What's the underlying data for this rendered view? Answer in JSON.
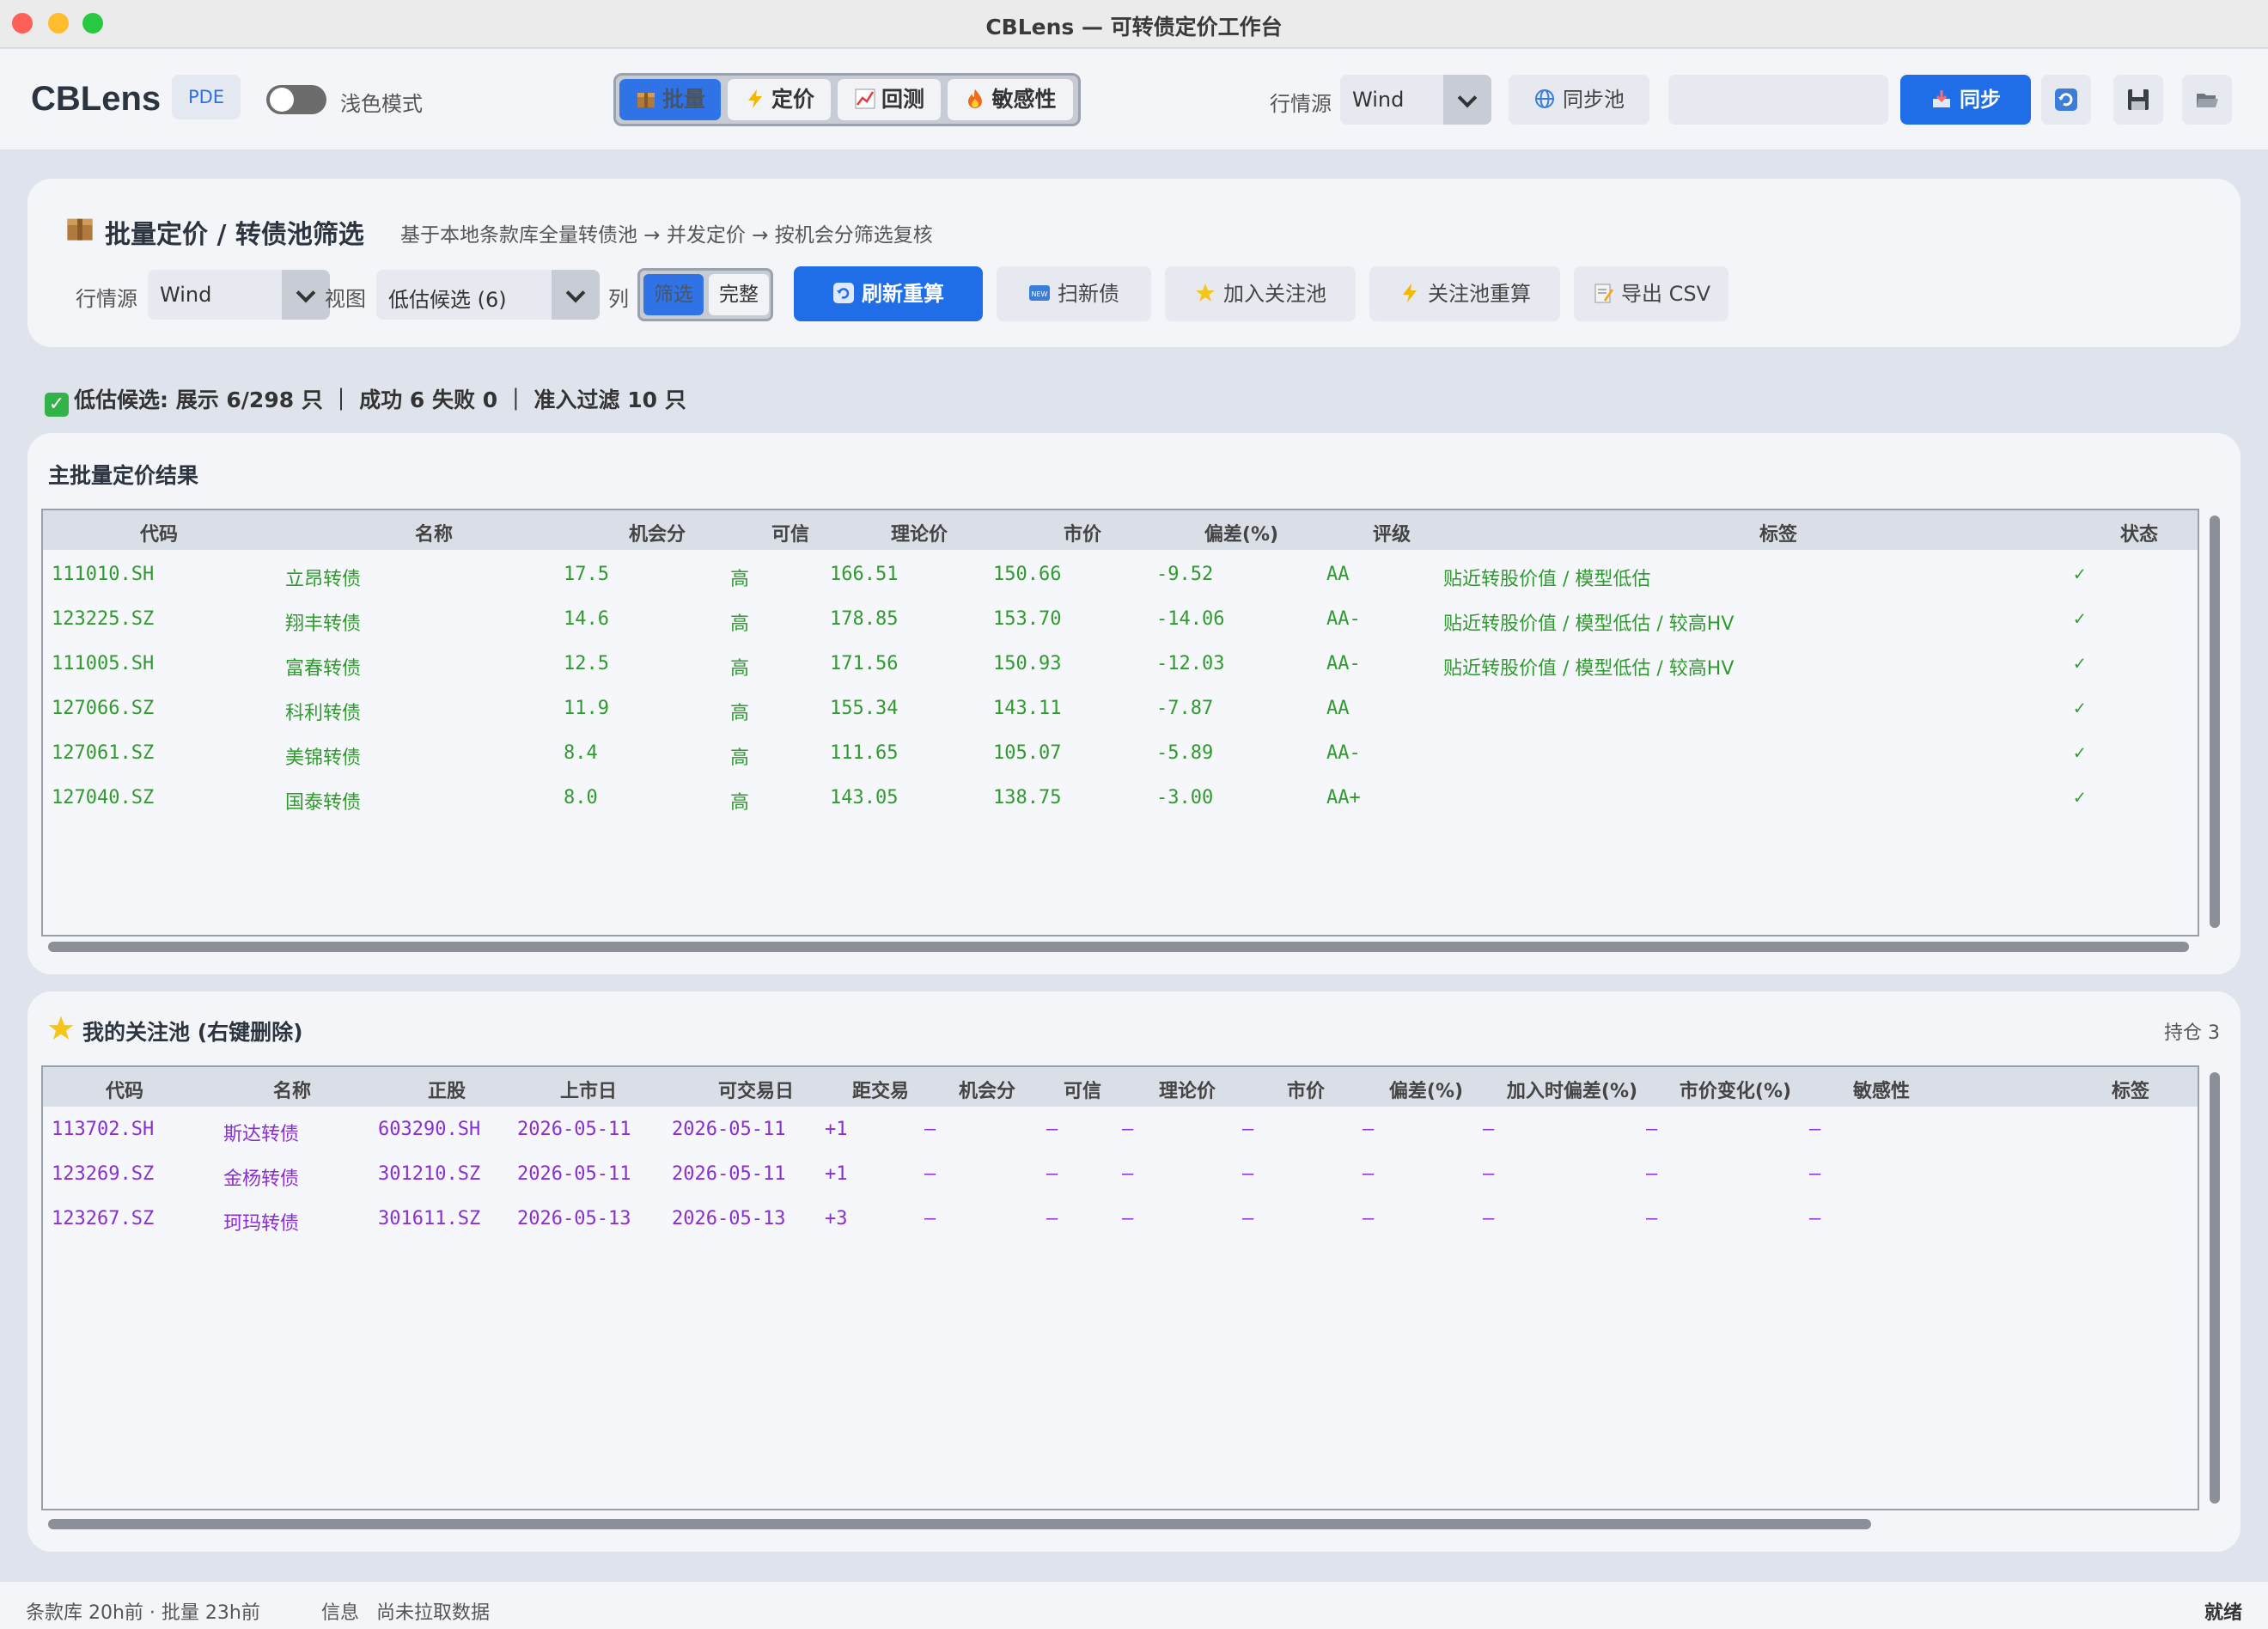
{
  "window": {
    "title": "CBLens — 可转债定价工作台"
  },
  "toolbar": {
    "brand": "CBLens",
    "badge": "PDE",
    "theme_toggle_label": "浅色模式",
    "tabs": [
      {
        "label": "批量",
        "icon": "package-icon",
        "active": true
      },
      {
        "label": "定价",
        "icon": "lightning-icon",
        "active": false
      },
      {
        "label": "回测",
        "icon": "chart-icon",
        "active": false
      },
      {
        "label": "敏感性",
        "icon": "fire-icon",
        "active": false
      }
    ],
    "source_label": "行情源",
    "source_value": "Wind",
    "sync_pool_label": "同步池",
    "sync_input_value": "",
    "sync_button_label": "同步",
    "accent_color": "#1f6ee8"
  },
  "batch_panel": {
    "title": "批量定价 / 转债池筛选",
    "subtitle": "基于本地条款库全量转债池 → 并发定价 → 按机会分筛选复核",
    "source_label": "行情源",
    "source_value": "Wind",
    "view_label": "视图",
    "view_value": "低估候选 (6)",
    "col_label": "列",
    "col_options": [
      "筛选",
      "完整"
    ],
    "refresh_label": "刷新重算",
    "scan_label": "扫新债",
    "add_watch_label": "加入关注池",
    "watch_recalc_label": "关注池重算",
    "export_label": "导出 CSV"
  },
  "status_line": "低估候选: 展示 6/298 只 ｜ 成功 6  失败 0 ｜ 准入过滤 10 只",
  "main_results": {
    "title": "主批量定价结果",
    "columns": [
      "代码",
      "名称",
      "机会分",
      "可信",
      "理论价",
      "市价",
      "偏差(%)",
      "评级",
      "标签",
      "状态"
    ],
    "rows": [
      [
        "111010.SH",
        "立昂转债",
        "17.5",
        "高",
        "166.51",
        "150.66",
        "-9.52",
        "AA",
        "贴近转股价值 / 模型低估",
        "✓"
      ],
      [
        "123225.SZ",
        "翔丰转债",
        "14.6",
        "高",
        "178.85",
        "153.70",
        "-14.06",
        "AA-",
        "贴近转股价值 / 模型低估 / 较高HV",
        "✓"
      ],
      [
        "111005.SH",
        "富春转债",
        "12.5",
        "高",
        "171.56",
        "150.93",
        "-12.03",
        "AA-",
        "贴近转股价值 / 模型低估 / 较高HV",
        "✓"
      ],
      [
        "127066.SZ",
        "科利转债",
        "11.9",
        "高",
        "155.34",
        "143.11",
        "-7.87",
        "AA",
        "",
        "✓"
      ],
      [
        "127061.SZ",
        "美锦转债",
        "8.4",
        "高",
        "111.65",
        "105.07",
        "-5.89",
        "AA-",
        "",
        "✓"
      ],
      [
        "127040.SZ",
        "国泰转债",
        "8.0",
        "高",
        "143.05",
        "138.75",
        "-3.00",
        "AA+",
        "",
        "✓"
      ]
    ]
  },
  "watchlist": {
    "title": "我的关注池 (右键删除)",
    "holding": "持仓 3",
    "columns": [
      "代码",
      "名称",
      "正股",
      "上市日",
      "可交易日",
      "距交易",
      "机会分",
      "可信",
      "理论价",
      "市价",
      "偏差(%)",
      "加入时偏差(%)",
      "市价变化(%)",
      "敏感性",
      "标签"
    ],
    "rows": [
      [
        "113702.SH",
        "斯达转债",
        "603290.SH",
        "2026-05-11",
        "2026-05-11",
        "+1",
        "—",
        "—",
        "—",
        "—",
        "—",
        "—",
        "—",
        "—",
        ""
      ],
      [
        "123269.SZ",
        "金杨转债",
        "301210.SZ",
        "2026-05-11",
        "2026-05-11",
        "+1",
        "—",
        "—",
        "—",
        "—",
        "—",
        "—",
        "—",
        "—",
        ""
      ],
      [
        "123267.SZ",
        "珂玛转债",
        "301611.SZ",
        "2026-05-13",
        "2026-05-13",
        "+3",
        "—",
        "—",
        "—",
        "—",
        "—",
        "—",
        "—",
        "—",
        ""
      ]
    ]
  },
  "statusbar": {
    "left": "条款库 20h前  ·  批量 23h前",
    "info_label": "信息",
    "info_value": "尚未拉取数据",
    "right": "就绪"
  }
}
